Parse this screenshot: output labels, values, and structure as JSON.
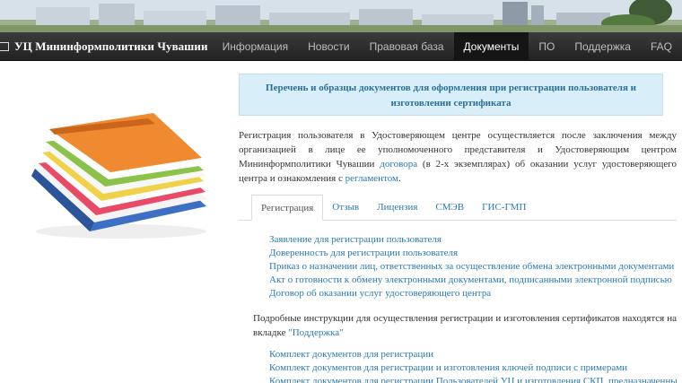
{
  "header": {
    "brand": "УЦ Мининформполитики Чувашии",
    "nav": [
      "Информация",
      "Новости",
      "Правовая база",
      "Документы",
      "ПО",
      "Поддержка",
      "FAQ"
    ],
    "active_nav": "Документы"
  },
  "notice": "Перечень и образцы документов для оформления при регистрации пользователя и изготовлении сертификата",
  "intro": {
    "part1": "Регистрация пользователя в Удостоверяющем центре осуществляется после заключения между организацией в лице ее уполномоченного представителя и Удостоверяющим центром Мининформполитики Чувашии ",
    "link1": "договора",
    "part2": " (в 2-х экземплярах) об оказании услуг удостоверяющего центра и ознакомления с ",
    "link2": "регламентом",
    "part3": "."
  },
  "tabs": [
    "Регистрация",
    "Отзыв",
    "Лицензия",
    "СМЭВ",
    "ГИС-ГМП"
  ],
  "registration_links": [
    "Заявление для регистрации пользователя",
    "Доверенность для регистрации пользователя",
    "Приказ о назначении лиц, ответственных за осуществление обмена электронными документами",
    "Акт о готовности к обмену электронными документами, подписанными электронной подписью",
    "Договор об оказании услуг удостоверяющего центра"
  ],
  "help": {
    "text": "Подробные инструкции для осуществления регистрации и изготовления сертификатов находятся на вкладке ",
    "link": "\"Поддержка\""
  },
  "kit_links": [
    "Комплект документов для регистрации",
    "Комплект документов для регистрации и изготовления ключей подписи с примерами",
    "Комплект документов для регистрации Пользователей УЦ и изготовления СКП, предназначенных к"
  ]
}
